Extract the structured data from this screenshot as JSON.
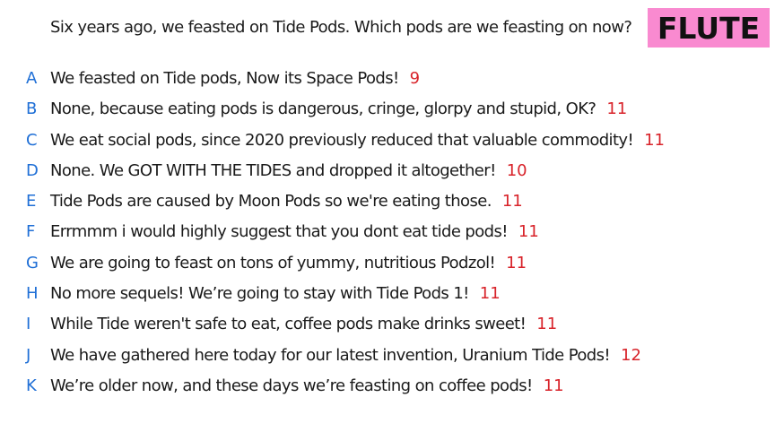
{
  "question": "Six years ago, we feasted on Tide Pods. Which pods are we feasting on now?",
  "badge": {
    "label": "FLUTE",
    "color": "#f98ad0"
  },
  "colors": {
    "letter": "#1f6fd6",
    "count": "#d8232a",
    "text": "#1a1a1a"
  },
  "answers": [
    {
      "letter": "A",
      "text": "We feasted on Tide pods, Now its Space Pods!",
      "count": "9"
    },
    {
      "letter": "B",
      "text": "None, because eating pods is dangerous, cringe, glorpy and stupid, OK?",
      "count": "11"
    },
    {
      "letter": "C",
      "text": "We eat social pods, since 2020 previously reduced that valuable commodity!",
      "count": "11"
    },
    {
      "letter": "D",
      "text": "None. We GOT WITH THE TIDES and dropped it altogether!",
      "count": "10"
    },
    {
      "letter": "E",
      "text": "Tide Pods are caused by Moon Pods so we're eating those.",
      "count": "11"
    },
    {
      "letter": "F",
      "text": "Errmmm i would highly suggest that you dont eat tide pods!",
      "count": "11"
    },
    {
      "letter": "G",
      "text": "We are going to feast on tons of yummy, nutritious Podzol!",
      "count": "11"
    },
    {
      "letter": "H",
      "text": "No more sequels! We’re going to stay with Tide Pods 1!",
      "count": "11"
    },
    {
      "letter": "I",
      "text": "While Tide weren't safe to eat, coffee pods make drinks sweet!",
      "count": "11"
    },
    {
      "letter": "J",
      "text": "We have gathered here today for our latest invention, Uranium Tide Pods!",
      "count": "12"
    },
    {
      "letter": "K",
      "text": "We’re older now, and these days we’re feasting on coffee pods!",
      "count": "11"
    }
  ]
}
